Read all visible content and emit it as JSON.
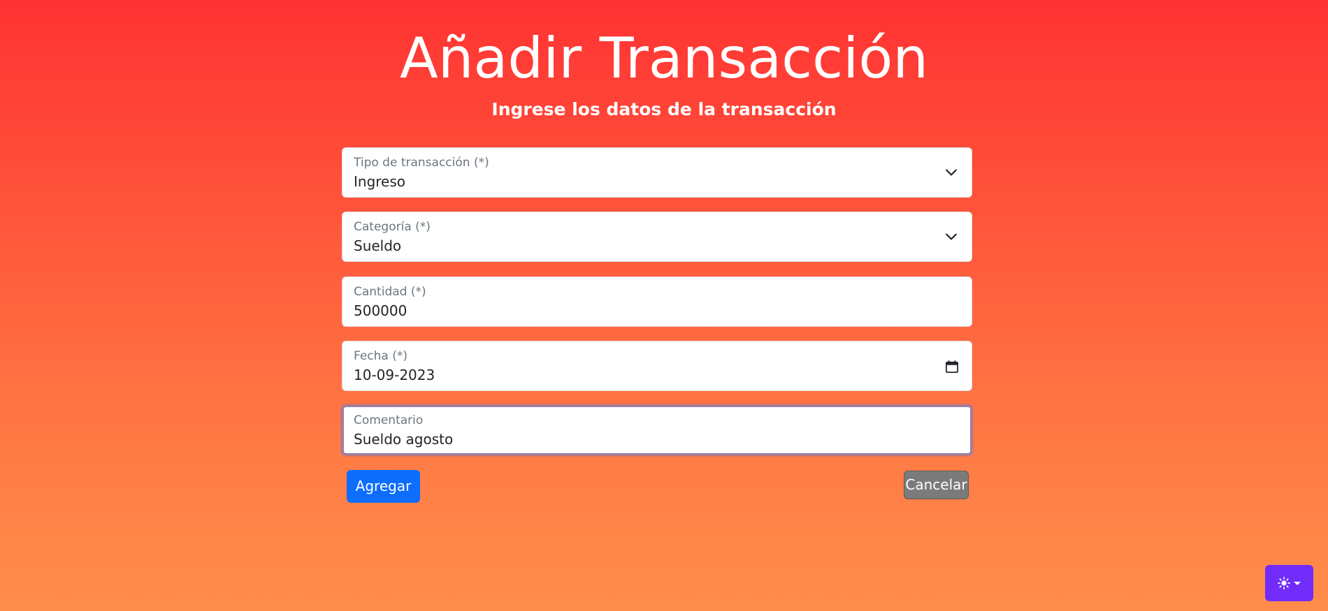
{
  "header": {
    "title": "Añadir Transacción",
    "subtitle": "Ingrese los datos de la transacción"
  },
  "form": {
    "transaction_type": {
      "label": "Tipo de transacción (*)",
      "value": "Ingreso",
      "icon": "chevron-down-icon"
    },
    "category": {
      "label": "Categoría (*)",
      "value": "Sueldo",
      "icon": "chevron-down-icon"
    },
    "amount": {
      "label": "Cantidad (*)",
      "value": "500000"
    },
    "date": {
      "label": "Fecha (*)",
      "value": "10-09-2023",
      "icon": "calendar-icon"
    },
    "comment": {
      "label": "Comentario",
      "value": "Sueldo agosto",
      "focused": true
    }
  },
  "actions": {
    "add_label": "Agregar",
    "cancel_label": "Cancelar"
  },
  "theme_toggle": {
    "icon": "sun-icon",
    "dropdown_icon": "caret-down-icon"
  },
  "colors": {
    "primary": "#0d6efd",
    "secondary": "#7b7b7b",
    "theme_toggle": "#712cf9",
    "background_top": "#ff3233",
    "background_bottom": "#ff8d4b"
  }
}
